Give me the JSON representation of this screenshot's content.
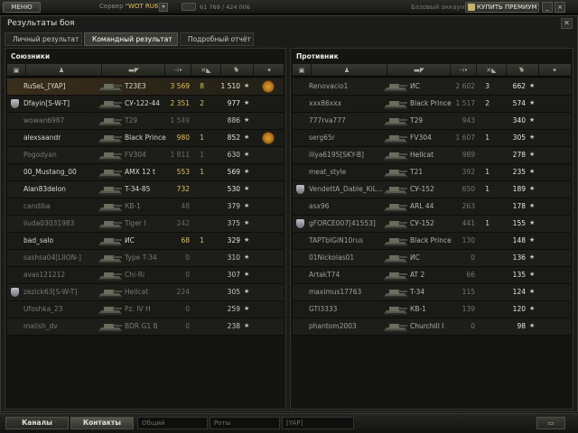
{
  "topbar": {
    "menu_label": "МЕНЮ",
    "server_label": "Сервер",
    "server_value": "\"WOT RU6\"",
    "online_count": "61 769 / 424 006",
    "account_type": "Базовый аккаунт",
    "premium_label": "КУПИТЬ ПРЕМИУМ"
  },
  "window": {
    "title": "Результаты боя",
    "tabs": [
      "Личный результат",
      "Командный результат",
      "Подробный отчёт"
    ],
    "active_tab": "Командный результат"
  },
  "allies": {
    "title": "Союзники",
    "rows": [
      {
        "player": "RuSeL_[YAP]",
        "tank": "T23E3",
        "damage": "3 569",
        "kills": "8",
        "xp": "1 510",
        "alive": true,
        "me": true,
        "medal": true,
        "clan": false
      },
      {
        "player": "Dfayin[S-W-T]",
        "tank": "СУ-122-44",
        "damage": "2 351",
        "kills": "2",
        "xp": "977",
        "alive": true,
        "me": false,
        "medal": false,
        "clan": true
      },
      {
        "player": "wowan6987",
        "tank": "T29",
        "damage": "1 549",
        "kills": "",
        "xp": "886",
        "alive": false,
        "me": false,
        "medal": false,
        "clan": false
      },
      {
        "player": "alexsaandr",
        "tank": "Black Prince",
        "damage": "980",
        "kills": "1",
        "xp": "852",
        "alive": true,
        "me": false,
        "medal": true,
        "clan": false
      },
      {
        "player": "Pogodyan",
        "tank": "FV304",
        "damage": "1 811",
        "kills": "1",
        "xp": "630",
        "alive": false,
        "me": false,
        "medal": false,
        "clan": false
      },
      {
        "player": "00_Mustang_00",
        "tank": "AMX 12 t",
        "damage": "553",
        "kills": "1",
        "xp": "569",
        "alive": true,
        "me": false,
        "medal": false,
        "clan": false
      },
      {
        "player": "Alan83delon",
        "tank": "T-34-85",
        "damage": "732",
        "kills": "",
        "xp": "530",
        "alive": true,
        "me": false,
        "medal": false,
        "clan": false
      },
      {
        "player": "candiba",
        "tank": "КВ-1",
        "damage": "48",
        "kills": "",
        "xp": "379",
        "alive": false,
        "me": false,
        "medal": false,
        "clan": false
      },
      {
        "player": "liuda03031983",
        "tank": "Tiger I",
        "damage": "242",
        "kills": "",
        "xp": "375",
        "alive": false,
        "me": false,
        "medal": false,
        "clan": false
      },
      {
        "player": "bad_salo",
        "tank": "ИС",
        "damage": "68",
        "kills": "1",
        "xp": "329",
        "alive": true,
        "me": false,
        "medal": false,
        "clan": false
      },
      {
        "player": "sashsa04[LIION-]",
        "tank": "Type T-34",
        "damage": "0",
        "kills": "",
        "xp": "310",
        "alive": false,
        "me": false,
        "medal": false,
        "clan": false
      },
      {
        "player": "avas121212",
        "tank": "Chi-Ri",
        "damage": "0",
        "kills": "",
        "xp": "307",
        "alive": false,
        "me": false,
        "medal": false,
        "clan": false
      },
      {
        "player": "zezick63[S-W-T]",
        "tank": "Hellcat",
        "damage": "224",
        "kills": "",
        "xp": "305",
        "alive": false,
        "me": false,
        "medal": false,
        "clan": true
      },
      {
        "player": "Ufoshka_23",
        "tank": "Pz. IV H",
        "damage": "0",
        "kills": "",
        "xp": "259",
        "alive": false,
        "me": false,
        "medal": false,
        "clan": false
      },
      {
        "player": "malish_dv",
        "tank": "BDR G1 B",
        "damage": "0",
        "kills": "",
        "xp": "238",
        "alive": false,
        "me": false,
        "medal": false,
        "clan": false
      }
    ]
  },
  "enemies": {
    "title": "Противник",
    "rows": [
      {
        "player": "Renovacio1",
        "tank": "ИС",
        "damage": "2 602",
        "kills": "3",
        "xp": "662",
        "clan": false
      },
      {
        "player": "xxx86xxx",
        "tank": "Black Prince",
        "damage": "1 517",
        "kills": "2",
        "xp": "574",
        "clan": false
      },
      {
        "player": "777rva777",
        "tank": "T29",
        "damage": "943",
        "kills": "",
        "xp": "340",
        "clan": false
      },
      {
        "player": "serg65r",
        "tank": "FV304",
        "damage": "1 607",
        "kills": "1",
        "xp": "305",
        "clan": false
      },
      {
        "player": "iliya6195[SKY-B]",
        "tank": "Hellcat",
        "damage": "989",
        "kills": "",
        "xp": "278",
        "clan": false
      },
      {
        "player": "meat_style",
        "tank": "T21",
        "damage": "392",
        "kills": "1",
        "xp": "235",
        "clan": false
      },
      {
        "player": "VendettA_Dable_KiL...",
        "tank": "СУ-152",
        "damage": "650",
        "kills": "1",
        "xp": "189",
        "clan": true
      },
      {
        "player": "asx96",
        "tank": "ARL 44",
        "damage": "263",
        "kills": "",
        "xp": "178",
        "clan": false
      },
      {
        "player": "gFORCE007[41553]",
        "tank": "СУ-152",
        "damage": "441",
        "kills": "1",
        "xp": "155",
        "clan": true
      },
      {
        "player": "TAPTbIGiN10rus",
        "tank": "Black Prince",
        "damage": "130",
        "kills": "",
        "xp": "148",
        "clan": false
      },
      {
        "player": "01Nickolas01",
        "tank": "ИС",
        "damage": "0",
        "kills": "",
        "xp": "136",
        "clan": false
      },
      {
        "player": "ArtakT74",
        "tank": "AT 2",
        "damage": "66",
        "kills": "",
        "xp": "135",
        "clan": false
      },
      {
        "player": "maximus17763",
        "tank": "T-34",
        "damage": "115",
        "kills": "",
        "xp": "124",
        "clan": false
      },
      {
        "player": "GTI3333",
        "tank": "КВ-1",
        "damage": "139",
        "kills": "",
        "xp": "120",
        "clan": false
      },
      {
        "player": "phantom2003",
        "tank": "Churchill I",
        "damage": "0",
        "kills": "",
        "xp": "98",
        "clan": false
      }
    ]
  },
  "bottombar": {
    "channels_label": "Каналы",
    "contacts_label": "Контакты",
    "channel_general": "Общий",
    "channel_company": "Роты",
    "channel_clan": "[YAP]"
  },
  "colors": {
    "accent_gold": "#e0c060",
    "me_row": "#3a2e1c",
    "background": "#141412"
  }
}
